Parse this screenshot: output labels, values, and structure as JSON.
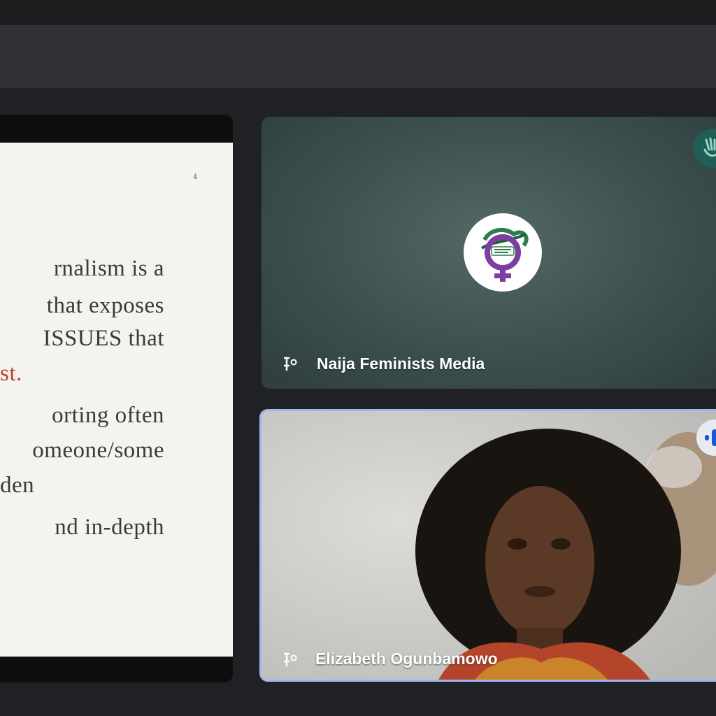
{
  "slide": {
    "page_number": "4",
    "lines": [
      "rnalism   is   a",
      "that  exposes",
      "ISSUES  that",
      "st.",
      "orting    often",
      "omeone/some",
      "den",
      "nd    in-depth"
    ]
  },
  "participants": [
    {
      "name": "Naija Feminists Media"
    },
    {
      "name": "Elizabeth Ogunbamowo"
    }
  ],
  "colors": {
    "accent_red": "#c0392b",
    "active_speaker_border": "#9fb6f2",
    "logo_green": "#2e7d4f",
    "logo_purple": "#7b3fa0"
  },
  "icons": [
    "pin-icon",
    "hand-raise-icon",
    "speaking-indicator-icon",
    "naija-feminists-logo"
  ]
}
